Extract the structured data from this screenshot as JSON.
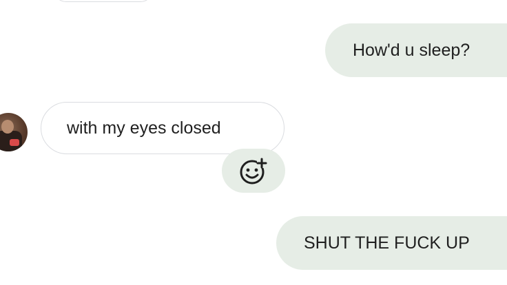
{
  "conversation": {
    "messages": [
      {
        "direction": "sent",
        "text": "How'd u sleep?"
      },
      {
        "direction": "received",
        "text": "with my eyes closed"
      },
      {
        "direction": "sent",
        "text": "SHUT THE FUCK UP"
      }
    ],
    "reaction_button": {
      "icon": "add-reaction-icon"
    }
  },
  "colors": {
    "sent_bubble": "#e6ede6",
    "received_border": "#dadce0",
    "text": "#1f1f1f"
  }
}
